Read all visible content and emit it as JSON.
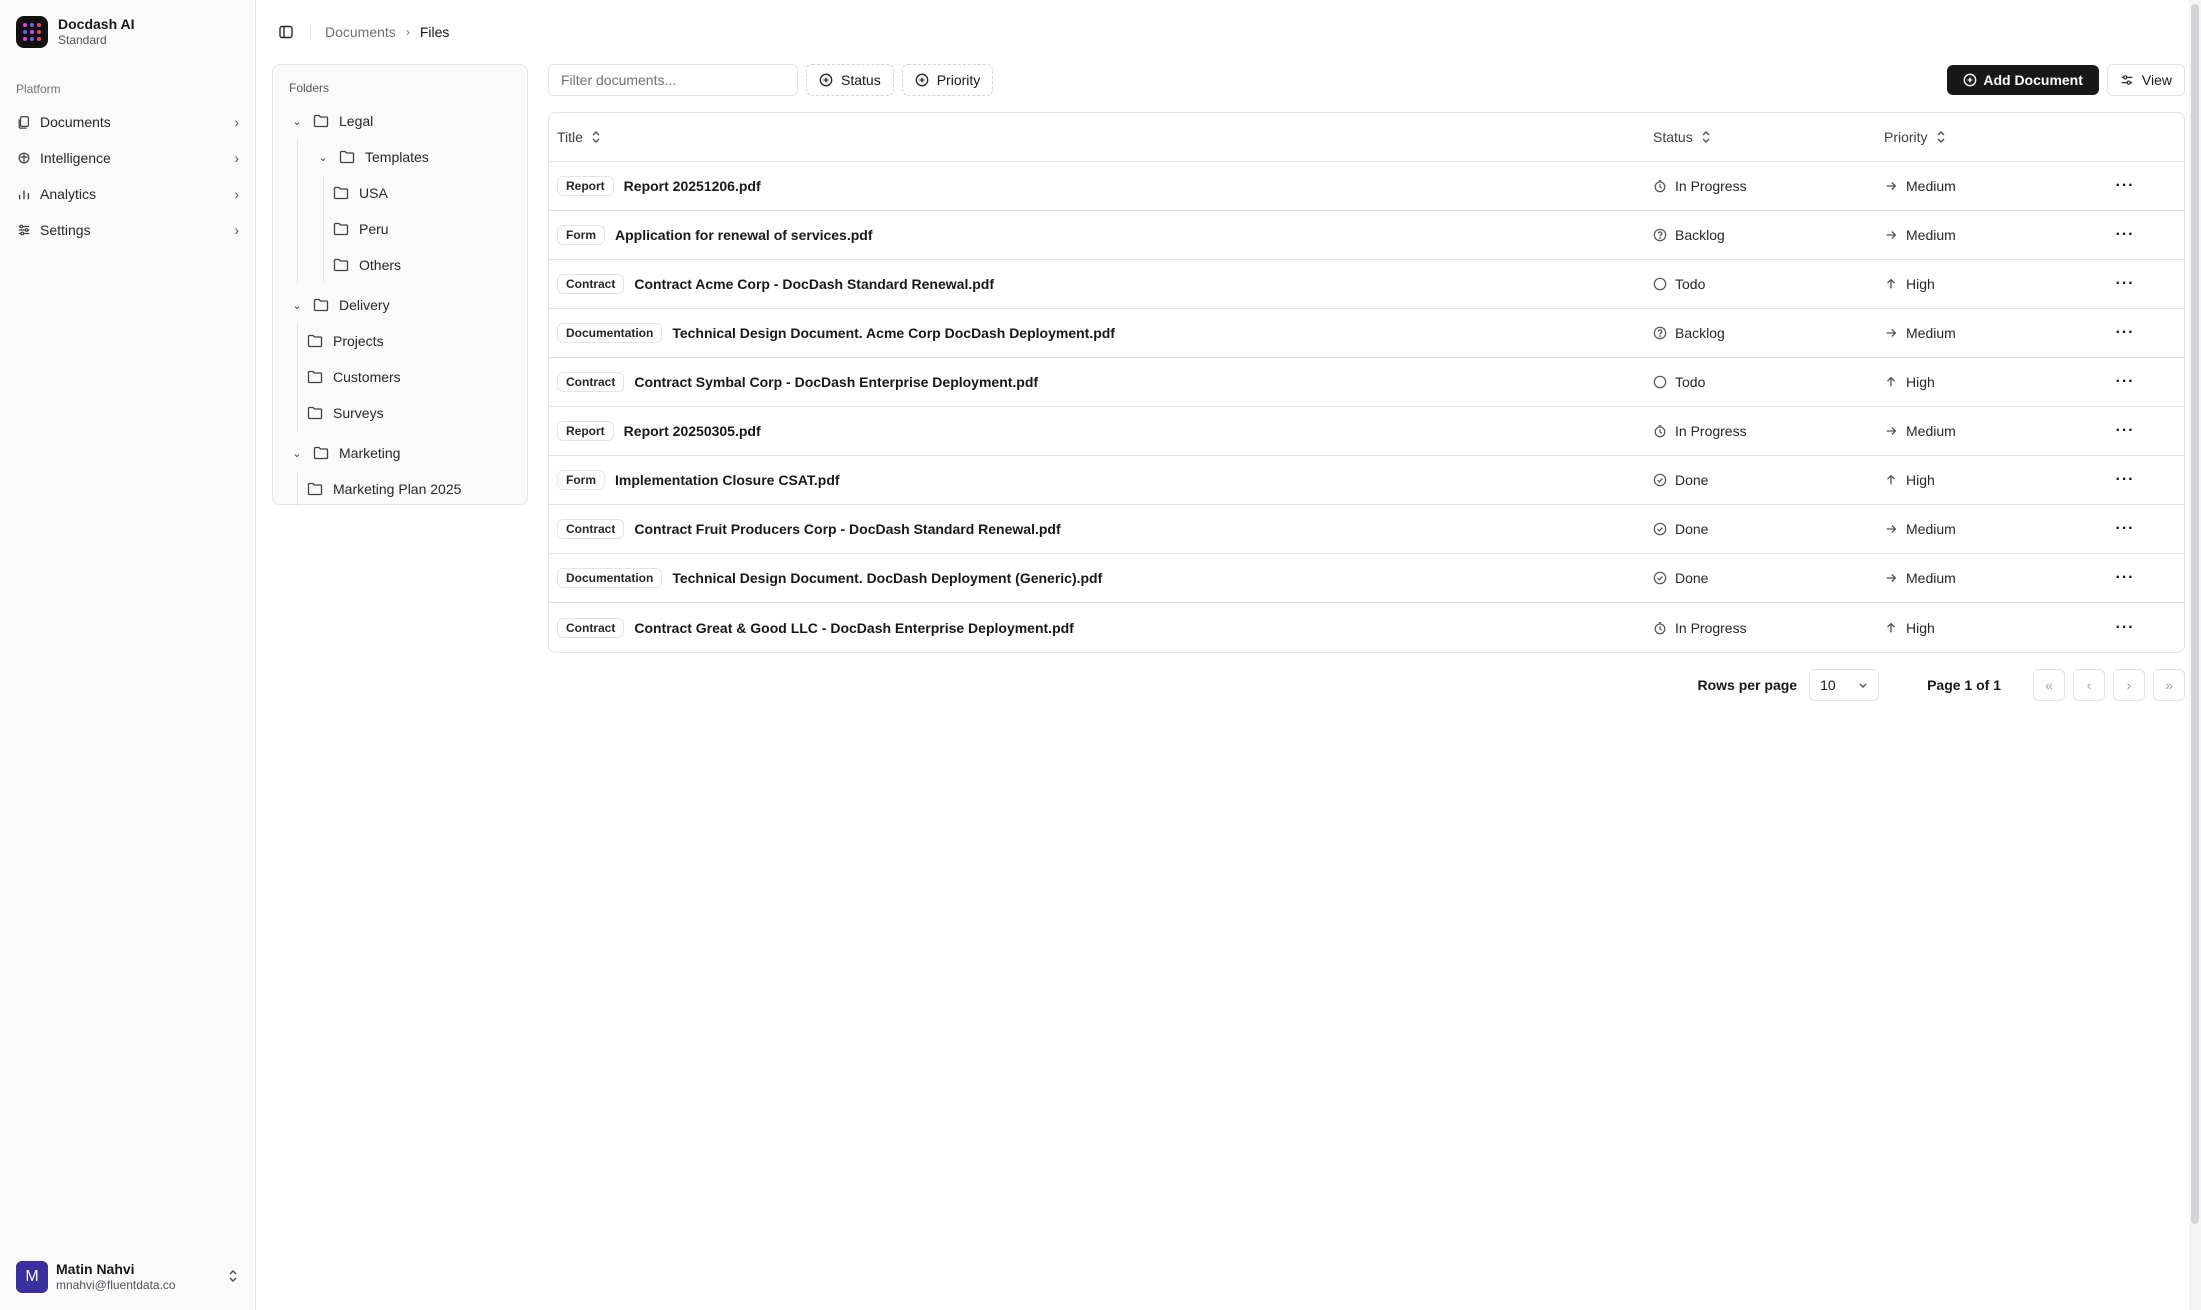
{
  "brand": {
    "name": "Docdash AI",
    "plan": "Standard"
  },
  "nav": {
    "section": "Platform",
    "items": [
      {
        "label": "Documents",
        "icon": "files-icon"
      },
      {
        "label": "Intelligence",
        "icon": "brain-icon"
      },
      {
        "label": "Analytics",
        "icon": "bar-chart-icon"
      },
      {
        "label": "Settings",
        "icon": "sliders-icon"
      }
    ]
  },
  "user": {
    "name": "Matin Nahvi",
    "email": "mnahvi@fluentdata.co",
    "initial": "M"
  },
  "breadcrumb": {
    "root": "Documents",
    "current": "Files"
  },
  "folders": {
    "title": "Folders",
    "legal": "Legal",
    "templates": "Templates",
    "usa": "USA",
    "peru": "Peru",
    "others": "Others",
    "delivery": "Delivery",
    "projects": "Projects",
    "customers": "Customers",
    "surveys": "Surveys",
    "marketing": "Marketing",
    "marketing_plan": "Marketing Plan 2025"
  },
  "toolbar": {
    "filter_placeholder": "Filter documents...",
    "status": "Status",
    "priority": "Priority",
    "add": "Add Document",
    "view": "View"
  },
  "table": {
    "headers": {
      "title": "Title",
      "status": "Status",
      "priority": "Priority"
    },
    "rows": [
      {
        "type": "Report",
        "title": "Report 20251206.pdf",
        "status": "In Progress",
        "priority": "Medium"
      },
      {
        "type": "Form",
        "title": "Application for renewal of services.pdf",
        "status": "Backlog",
        "priority": "Medium"
      },
      {
        "type": "Contract",
        "title": "Contract Acme Corp - DocDash Standard Renewal.pdf",
        "status": "Todo",
        "priority": "High"
      },
      {
        "type": "Documentation",
        "title": "Technical Design Document. Acme Corp DocDash Deployment.pdf",
        "status": "Backlog",
        "priority": "Medium"
      },
      {
        "type": "Contract",
        "title": "Contract Symbal Corp - DocDash Enterprise Deployment.pdf",
        "status": "Todo",
        "priority": "High"
      },
      {
        "type": "Report",
        "title": "Report 20250305.pdf",
        "status": "In Progress",
        "priority": "Medium"
      },
      {
        "type": "Form",
        "title": "Implementation Closure CSAT.pdf",
        "status": "Done",
        "priority": "High"
      },
      {
        "type": "Contract",
        "title": "Contract Fruit Producers Corp - DocDash Standard Renewal.pdf",
        "status": "Done",
        "priority": "Medium"
      },
      {
        "type": "Documentation",
        "title": "Technical Design Document. DocDash Deployment (Generic).pdf",
        "status": "Done",
        "priority": "Medium"
      },
      {
        "type": "Contract",
        "title": "Contract Great & Good LLC - DocDash Enterprise Deployment.pdf",
        "status": "In Progress",
        "priority": "High"
      }
    ]
  },
  "pagination": {
    "rows_label": "Rows per page",
    "rows_value": "10",
    "page_info": "Page 1 of 1"
  }
}
